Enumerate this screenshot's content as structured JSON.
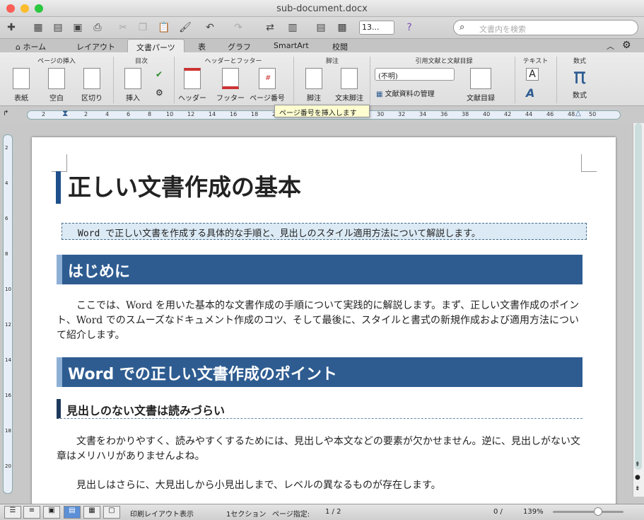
{
  "window": {
    "title": "sub-document.docx"
  },
  "toolbar": {
    "zoom_value": "13...",
    "search_placeholder": "文書内を検索"
  },
  "tabs": [
    "ホーム",
    "レイアウト",
    "文書パーツ",
    "表",
    "グラフ",
    "SmartArt",
    "校閲"
  ],
  "ribbon": {
    "groups": [
      "ページの挿入",
      "目次",
      "ヘッダーとフッター",
      "脚注",
      "引用文献と文献目録",
      "テキスト",
      "数式"
    ],
    "buttons": [
      "表紙",
      "空白",
      "区切り",
      "挿入",
      "ヘッダー",
      "フッター",
      "ページ番号",
      "脚注",
      "文末脚注",
      "文献目録",
      "数式"
    ],
    "citation_style": "(不明)",
    "manage_sources": "文献資料の管理",
    "tooltip": "ページ番号を挿入します"
  },
  "ruler": {
    "ticks": [
      "2",
      "2",
      "2",
      "4",
      "6",
      "8",
      "10",
      "12",
      "14",
      "16",
      "18",
      "20",
      "30",
      "32",
      "34",
      "36",
      "38",
      "40",
      "42",
      "44",
      "46",
      "48",
      "50"
    ],
    "vticks": [
      "2",
      "4",
      "6",
      "8",
      "10",
      "12",
      "14",
      "16",
      "18",
      "20"
    ]
  },
  "document": {
    "title": "正しい文書作成の基本",
    "subtitle": "Word で正しい文書を作成する具体的な手順と、見出しのスタイル適用方法について解説します。",
    "h2_intro": "はじめに",
    "intro_text": "ここでは、Word を用いた基本的な文書作成の手順について実践的に解説します。まず、正しい文書作成のポイント、Word でのスムーズなドキュメント作成のコツ、そして最後に、スタイルと書式の新規作成および適用方法について紹介します。",
    "h2_points": "Word での正しい文書作成のポイント",
    "h3_headings": "見出しのない文書は読みづらい",
    "para1": "文書をわかりやすく、読みやすくするためには、見出しや本文などの要素が欠かせません。逆に、見出しがない文章はメリハリがありませんよね。",
    "para2": "見出しはさらに、大見出しから小見出しまで、レベルの異なるものが存在します。"
  },
  "status": {
    "view": "印刷レイアウト表示",
    "section": "1セクション",
    "page_label": "ページ指定:",
    "page": "1 / 2",
    "words": "0 /",
    "zoom": "139%"
  }
}
